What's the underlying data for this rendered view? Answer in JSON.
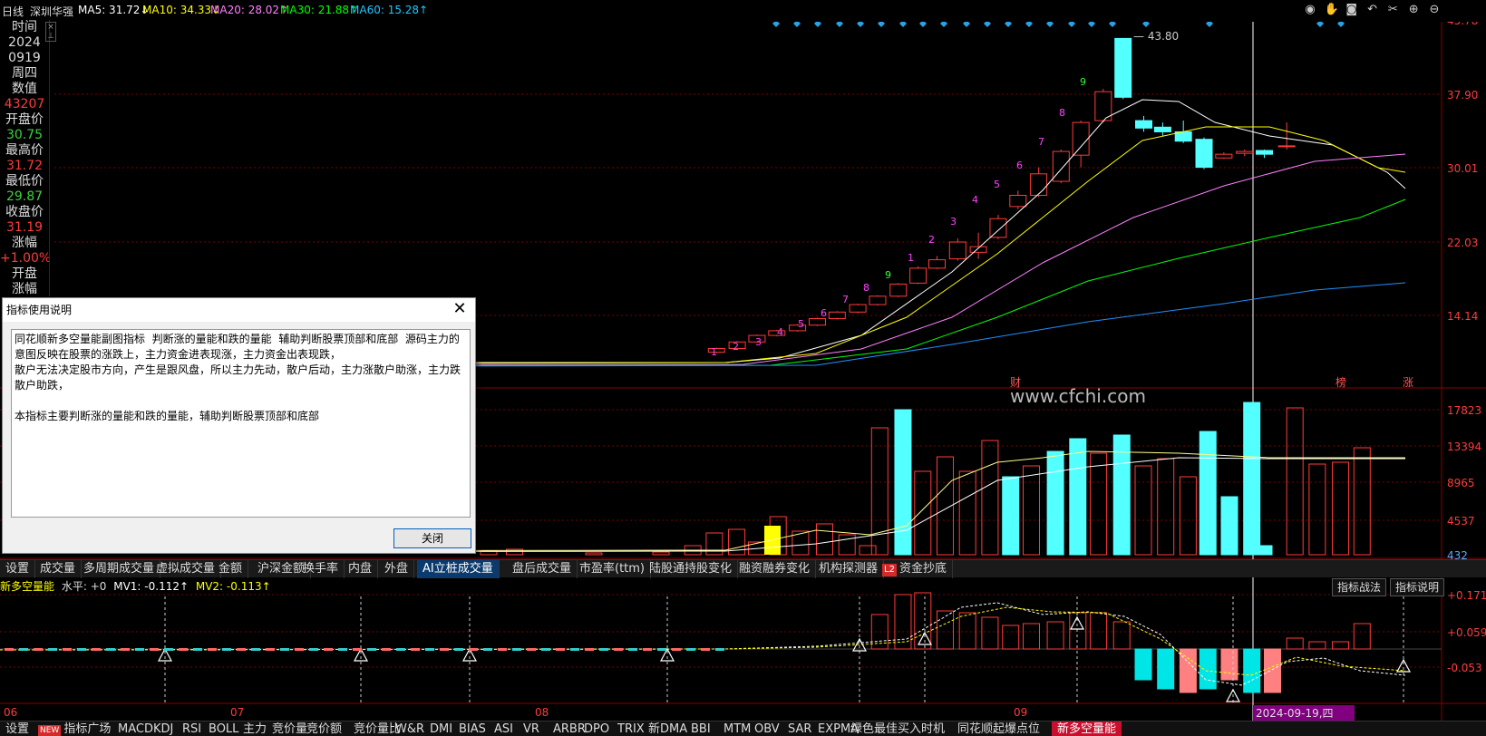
{
  "header": {
    "period": "日线",
    "stock_name": "深圳华强",
    "ma5": "MA5: 31.72↓",
    "ma10": "MA10: 34.33↓",
    "ma20": "MA20: 28.02↑",
    "ma30": "MA30: 21.88↑",
    "ma60": "MA60: 15.28↑",
    "toolbar_icons": [
      "eye-icon",
      "hand-icon",
      "record-icon",
      "undo-icon",
      "scissors-icon",
      "zoom-in-icon",
      "zoom-out-icon"
    ]
  },
  "info_panel": {
    "time_label": "时间",
    "year": "2024",
    "date": "0919",
    "weekday": "周四",
    "value_label": "数值",
    "value": "43207",
    "open_label": "开盘价",
    "open": "30.75",
    "high_label": "最高价",
    "high": "31.72",
    "low_label": "最低价",
    "low": "29.87",
    "close_label": "收盘价",
    "close": "31.19",
    "change_label": "涨幅",
    "change": "+1.00%",
    "open_change_label": "开盘",
    "open_change_label2": "涨幅"
  },
  "colors": {
    "up": "#ff3b3b",
    "down": "#54ffff",
    "ma5": "#ffffff",
    "ma10": "#ffff00",
    "ma20": "#ff80ff",
    "ma30": "#00ff00",
    "ma60": "#1e90ff",
    "axis_text": "#ff3b3b",
    "grid": "#7a0000"
  },
  "chart_data": [
    {
      "type": "candlestick",
      "title": "深圳华强",
      "y_ticks": [
        "45.78",
        "37.90",
        "30.01",
        "22.03",
        "14.14"
      ],
      "peak_annotation": "43.80",
      "sequence_labels": [
        "1",
        "2",
        "3",
        "4",
        "5",
        "6",
        "7",
        "8",
        "9",
        "1",
        "2",
        "3",
        "4",
        "5",
        "6",
        "7",
        "8",
        "9"
      ],
      "event_labels": [
        "财",
        "榜",
        "涨"
      ],
      "watermark": "www.cfchi.com"
    },
    {
      "type": "bar",
      "title": "成交量",
      "y_ticks": [
        "17823",
        "13394",
        "8965",
        "4537",
        "432"
      ]
    },
    {
      "type": "bar",
      "title": "新多空量能",
      "header_name": "新多空量能",
      "level": "水平: +0",
      "mv1": "MV1: -0.112↑",
      "mv2": "MV2: -0.113↑",
      "y_ticks": [
        "+0.171",
        "+0.059",
        "-0.053"
      ],
      "x_ticks": [
        "06",
        "07",
        "08",
        "09"
      ],
      "cursor_date": "2024-09-19,四"
    }
  ],
  "mid_tabs": [
    {
      "label": "设置"
    },
    {
      "label": "成交量"
    },
    {
      "label": "多周期成交量"
    },
    {
      "label": "虚拟成交量"
    },
    {
      "label": "金额"
    },
    {
      "label": "沪深金额"
    },
    {
      "label": "换手率"
    },
    {
      "label": "内盘"
    },
    {
      "label": "外盘"
    },
    {
      "label": "AI立桩成交量",
      "active": true
    },
    {
      "label": "盘后成交量"
    },
    {
      "label": "市盈率(ttm)"
    },
    {
      "label": "陆股通持股变化"
    },
    {
      "label": "融资融券变化"
    },
    {
      "label": "机构探测器"
    },
    {
      "label": "资金抄底",
      "badge": "L2"
    }
  ],
  "sub_buttons": {
    "strategy": "指标战法",
    "explain": "指标说明"
  },
  "bottom_tabs": [
    {
      "label": "设置"
    },
    {
      "label": "指标广场",
      "badge": "NEW"
    },
    {
      "label": "MACD"
    },
    {
      "label": "KDJ"
    },
    {
      "label": "RSI"
    },
    {
      "label": "BOLL"
    },
    {
      "label": "主力"
    },
    {
      "label": "竞价量"
    },
    {
      "label": "竞价额"
    },
    {
      "label": "竞价量比"
    },
    {
      "label": "W&R"
    },
    {
      "label": "DMI"
    },
    {
      "label": "BIAS"
    },
    {
      "label": "ASI"
    },
    {
      "label": "VR"
    },
    {
      "label": "ARBR"
    },
    {
      "label": "DPO"
    },
    {
      "label": "TRIX"
    },
    {
      "label": "新DMA"
    },
    {
      "label": "BBI"
    },
    {
      "label": "MTM"
    },
    {
      "label": "OBV"
    },
    {
      "label": "SAR"
    },
    {
      "label": "EXPMA"
    },
    {
      "label": "绿色最佳买入时机"
    },
    {
      "label": "同花顺起爆点位"
    },
    {
      "label": "新多空量能",
      "active": true
    }
  ],
  "dialog": {
    "title": "指标使用说明",
    "body": "同花顺新多空量能副图指标  判断涨的量能和跌的量能  辅助判断股票顶部和底部  源码主力的意图反映在股票的涨跌上，主力资金进表现涨，主力资金出表现跌，\n散户无法决定股市方向，产生是跟风盘，所以主力先动，散户后动，主力涨散户助涨，主力跌散户助跌，\n\n本指标主要判断涨的量能和跌的量能，辅助判断股票顶部和底部",
    "close_button": "关闭"
  }
}
